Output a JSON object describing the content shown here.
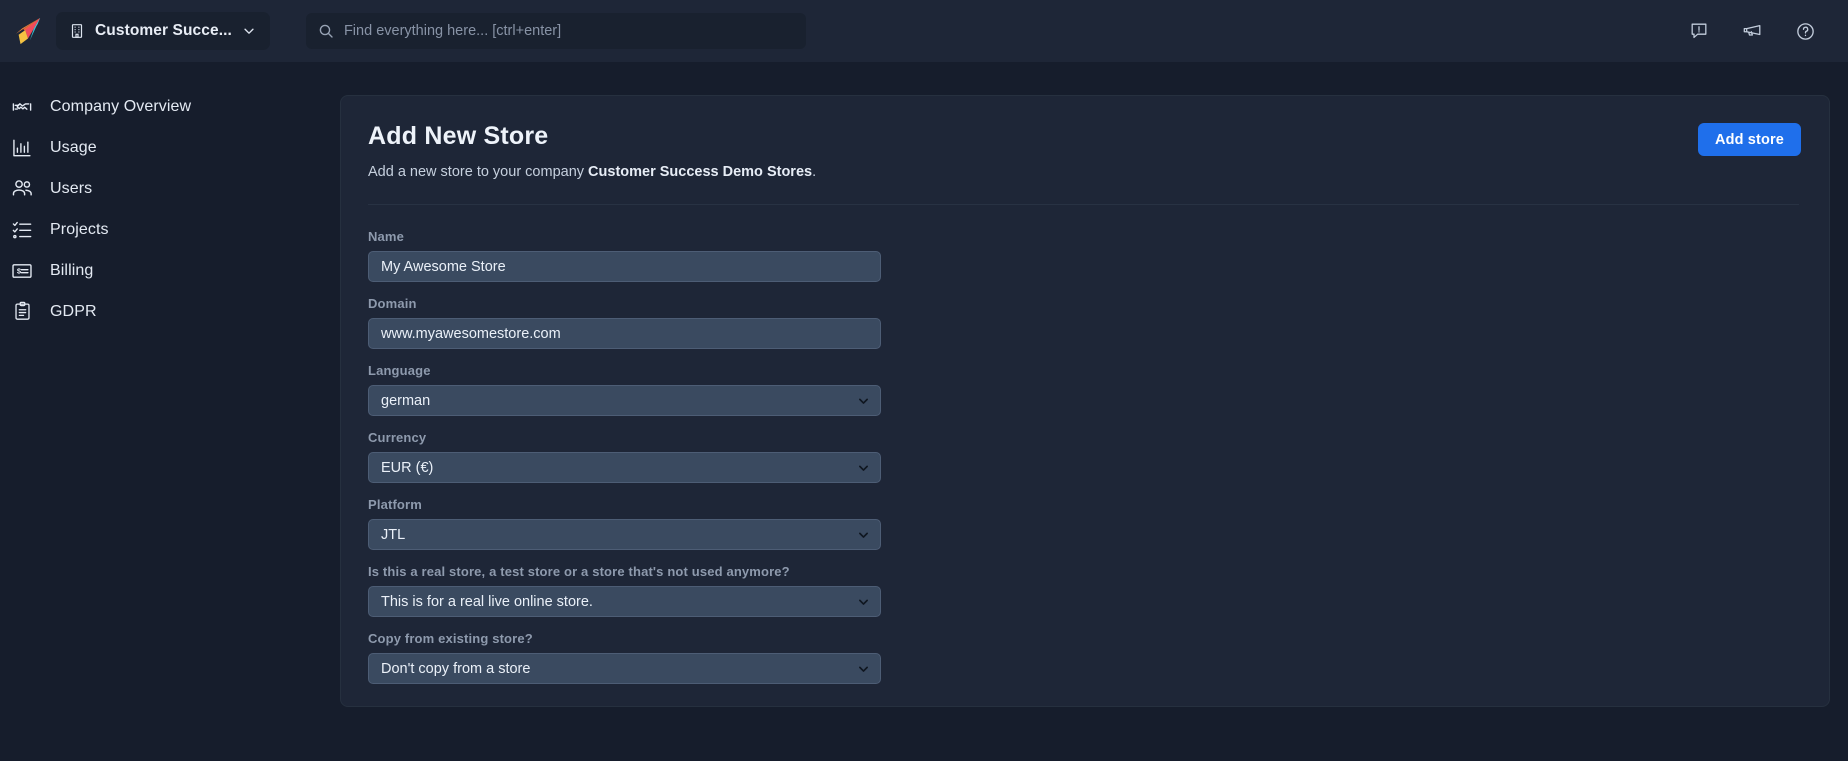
{
  "topbar": {
    "logo_icon": "paper-plane-logo",
    "company_selector": {
      "icon": "building-icon",
      "label": "Customer Succe...",
      "chevron_icon": "chevron-down-icon"
    },
    "search": {
      "icon": "search-icon",
      "value": "",
      "placeholder": "Find everything here... [ctrl+enter]"
    },
    "actions": [
      {
        "name": "feedback-icon",
        "title": "Feedback"
      },
      {
        "name": "megaphone-icon",
        "title": "Announcements"
      },
      {
        "name": "help-icon",
        "title": "Help"
      }
    ]
  },
  "sidebar": {
    "items": [
      {
        "label": "Company Overview",
        "icon": "handshake-icon"
      },
      {
        "label": "Usage",
        "icon": "bar-chart-icon"
      },
      {
        "label": "Users",
        "icon": "users-icon"
      },
      {
        "label": "Projects",
        "icon": "checklist-icon"
      },
      {
        "label": "Billing",
        "icon": "billing-card-icon"
      },
      {
        "label": "GDPR",
        "icon": "clipboard-icon"
      }
    ]
  },
  "main": {
    "title": "Add New Store",
    "subtitle_prefix": "Add a new store to your company ",
    "subtitle_company": "Customer Success Demo Stores",
    "subtitle_suffix": ".",
    "add_store_label": "Add store",
    "fields": [
      {
        "label": "Name",
        "type": "text",
        "value": "My Awesome Store"
      },
      {
        "label": "Domain",
        "type": "text",
        "value": "www.myawesomestore.com"
      },
      {
        "label": "Language",
        "type": "select",
        "value": "german"
      },
      {
        "label": "Currency",
        "type": "select",
        "value": "EUR (€)"
      },
      {
        "label": "Platform",
        "type": "select",
        "value": "JTL"
      },
      {
        "label": "Is this a real store, a test store or a store that's not used anymore?",
        "type": "select",
        "value": "This is for a real live online store."
      },
      {
        "label": "Copy from existing store?",
        "type": "select",
        "value": "Don't copy from a store"
      }
    ]
  },
  "colors": {
    "app_background": "#161d2c",
    "panel": "#1e2637",
    "input": "#3a4a60",
    "accent": "#1f6feb",
    "label_text": "#8e9aad",
    "body_text": "#e4eaf3"
  }
}
